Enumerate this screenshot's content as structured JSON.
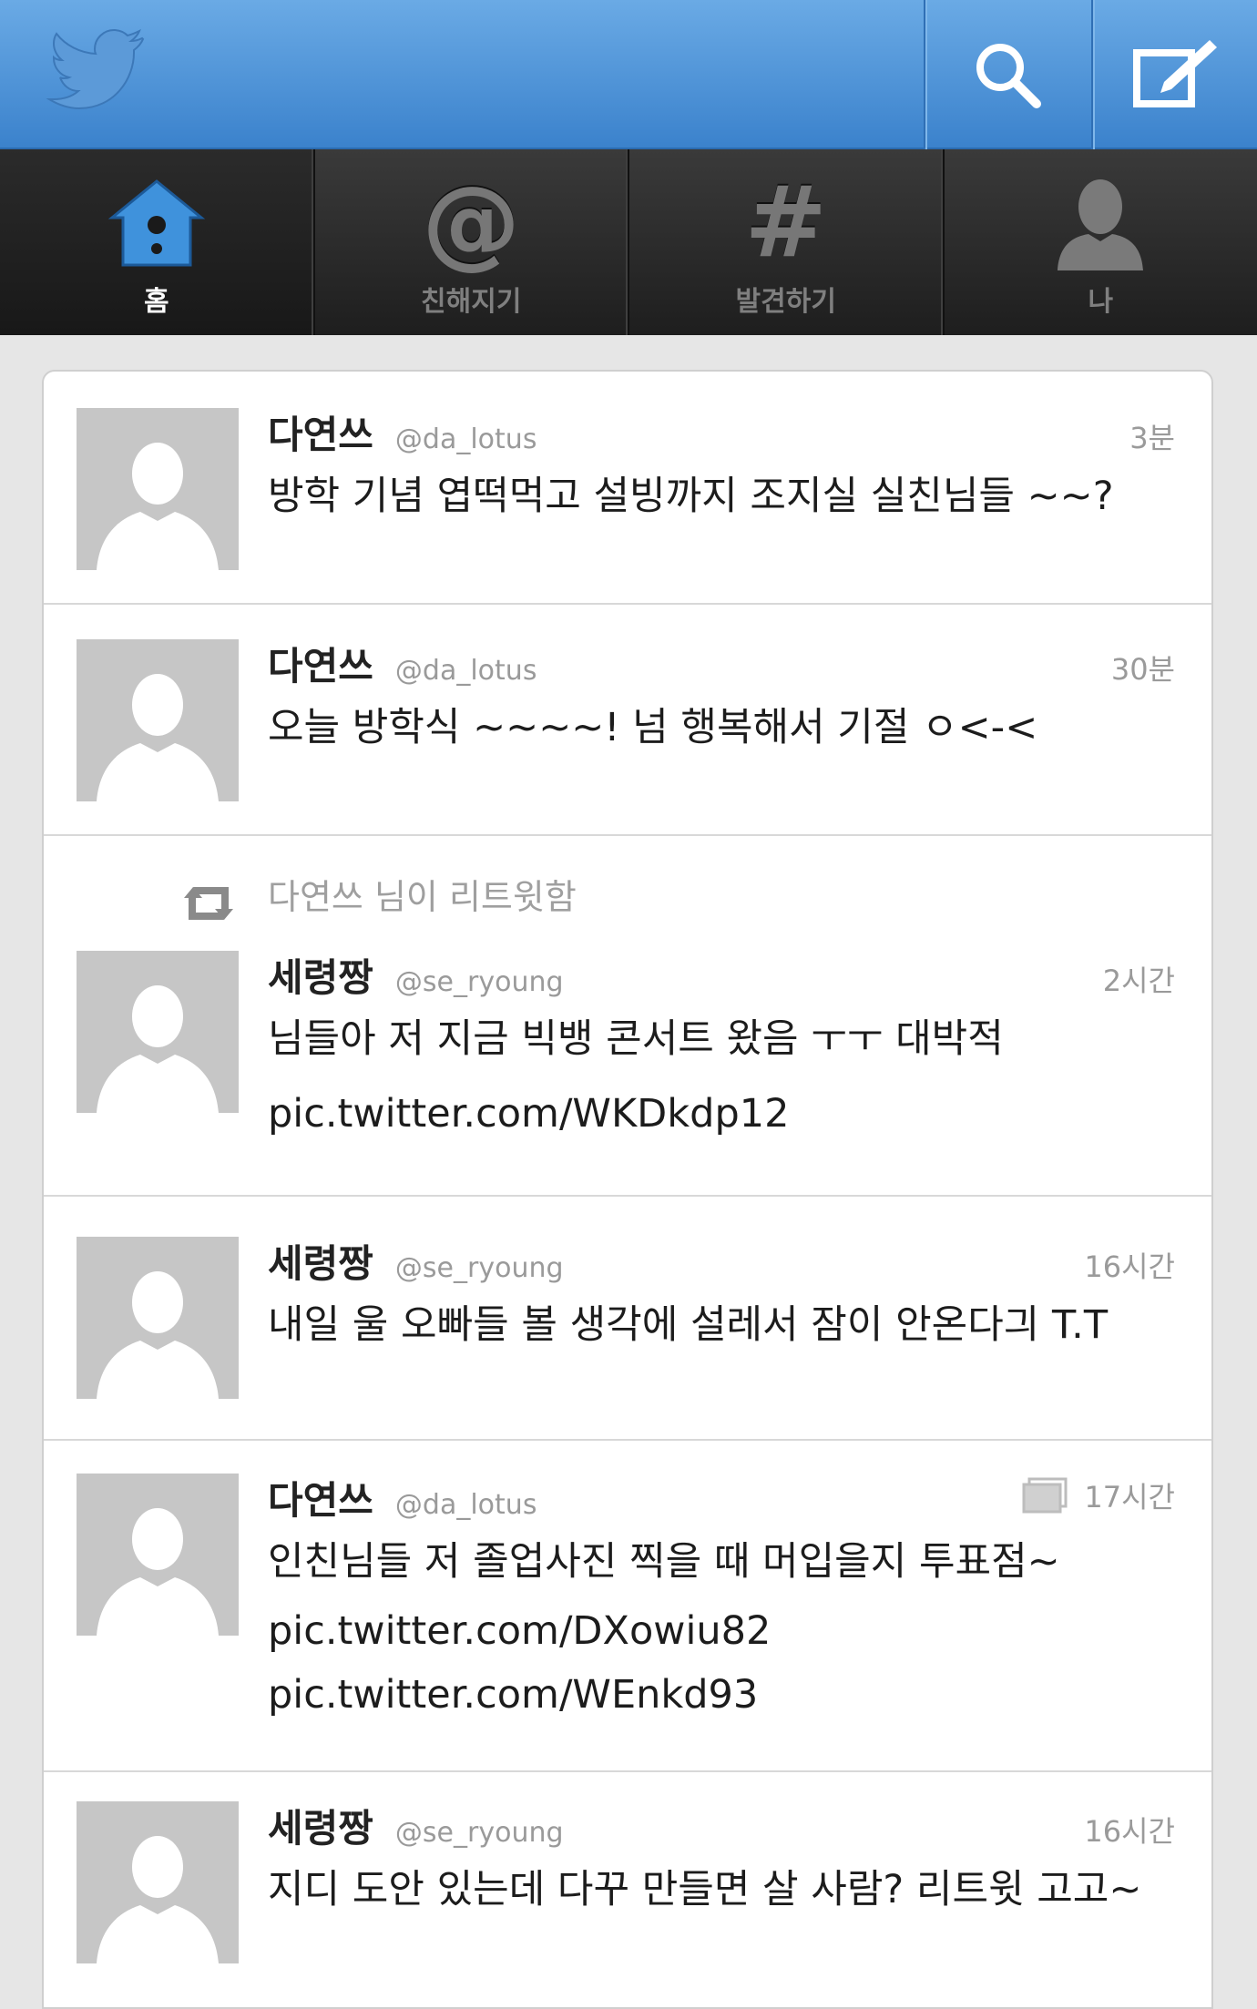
{
  "header": {
    "logo": "twitter-bird-icon",
    "search_icon": "search-icon",
    "compose_icon": "compose-icon"
  },
  "tabs": [
    {
      "label": "홈",
      "icon": "home-icon",
      "active": true
    },
    {
      "label": "친해지기",
      "icon": "at-icon",
      "active": false
    },
    {
      "label": "발견하기",
      "icon": "hashtag-icon",
      "active": false
    },
    {
      "label": "나",
      "icon": "profile-icon",
      "active": false
    }
  ],
  "timeline": [
    {
      "name": "다연쓰",
      "handle": "@da_lotus",
      "time": "3분",
      "lines": [
        "방학 기념 엽떡먹고 설빙까지 조지실 실친님들 ~~?"
      ]
    },
    {
      "name": "다연쓰",
      "handle": "@da_lotus",
      "time": "30분",
      "lines": [
        "오늘 방학식 ~~~~! 넘 행복해서 기절 ㅇ<-<"
      ]
    },
    {
      "retweet_by": "다연쓰 님이 리트윗함",
      "name": "세령짱",
      "handle": "@se_ryoung",
      "time": "2시간",
      "lines": [
        "님들아 저 지금 빅뱅 콘서트 왔음 ㅜㅜ 대박적",
        "pic.twitter.com/WKDkdp12"
      ]
    },
    {
      "name": "세령짱",
      "handle": "@se_ryoung",
      "time": "16시간",
      "lines": [
        "내일 울 오빠들 볼 생각에 설레서 잠이 안온다긔 T.T"
      ]
    },
    {
      "name": "다연쓰",
      "handle": "@da_lotus",
      "time": "17시간",
      "has_media": true,
      "lines": [
        "인친님들 저 졸업사진 찍을 때 머입을지 투표점~",
        "pic.twitter.com/DXowiu82",
        "pic.twitter.com/WEnkd93"
      ]
    },
    {
      "name": "세령짱",
      "handle": "@se_ryoung",
      "time": "16시간",
      "lines": [
        "지디 도안 있는데 다꾸 만들면 살 사람? 리트윗 고고~"
      ]
    }
  ],
  "colors": {
    "header_blue": "#4a90d9",
    "tab_dark": "#2a2a2a",
    "home_icon_blue": "#3f92dc"
  }
}
